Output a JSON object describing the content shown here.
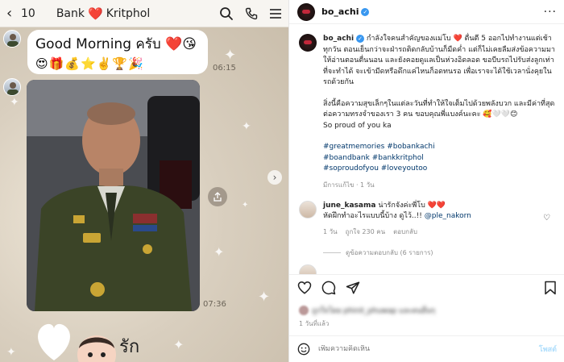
{
  "chat": {
    "unread_count": "10",
    "title_left": "Bank",
    "title_heart": "❤️",
    "title_right": "Kritphol",
    "message_text": "Good Morning ครับ ❤️😘",
    "message_emoji": "😍🎁💰⭐✌️🏆🎉",
    "message_time": "06:15",
    "photo_time": "07:36",
    "sticker_text": "รัก"
  },
  "instagram": {
    "header": {
      "username": "bo_achi"
    },
    "caption": {
      "username": "bo_achi",
      "line1": "กำลังใจคนสำคัญของแม่โบ ❤️ ตื่นตี 5 ออกไปทำงานแต่เช้าทุกวัน ตอนเย็นกว่าจะฝ่ารถติดกลับบ้านก็มืดค่ำ แต่ก็ไม่เคยลืมส่งข้อความมาให้อ่านตอนตื่นนอน และยังคอยดูแลเป็นห่วงอิดลอด ขอบีบรถไปรับส่งลูกเท่าที่จะทำได้ จะเข้ามีดหรือดึกแค่ไหนก็อดทนรอ เพื่อเราจะได้ใช้เวลานั่งคุยในรถด้วยกัน",
      "line2": "สิ่งนี้คือความสุขเล็กๆในแต่ละวันที่ทำให้ใจเต็มไปด้วยพลังบวก และมีค่าที่สุดต่อความทรงจำของเรา 3 คน ขอบคุณพี่แบงค์นะคะ 🥰🤍🤍😊",
      "line3": "So proud of you ka",
      "hashtags_1": "#greatmemories #bobankachi",
      "hashtags_2": "#boandbank #bankkritphol",
      "hashtags_3": "#soproudofyou #loveyoutoo",
      "meta": "มีการแก้ไข · 1 วัน"
    },
    "comment": {
      "username": "june_kasama",
      "text": "น่ารักจังค่ะพี่โบ ❤️❤️",
      "text2_pre": "หัดฝึกทำอะไรแบบนี้บ้าง ดูไว้..!!",
      "mention": "@ple_nakorn",
      "time": "1 วัน",
      "likes": "ถูกใจ 230 คน",
      "reply": "ตอบกลับ",
      "view_replies": "ดูข้อความตอบกลับ (6 รายการ)"
    },
    "likes_blur_text": "ถูกใจโดย phinit_phuwap และคนอื่นๆ",
    "post_date": "1 วันที่แล้ว",
    "add_comment_placeholder": "เพิ่มความคิดเห็น",
    "post_button": "โพสต์"
  }
}
